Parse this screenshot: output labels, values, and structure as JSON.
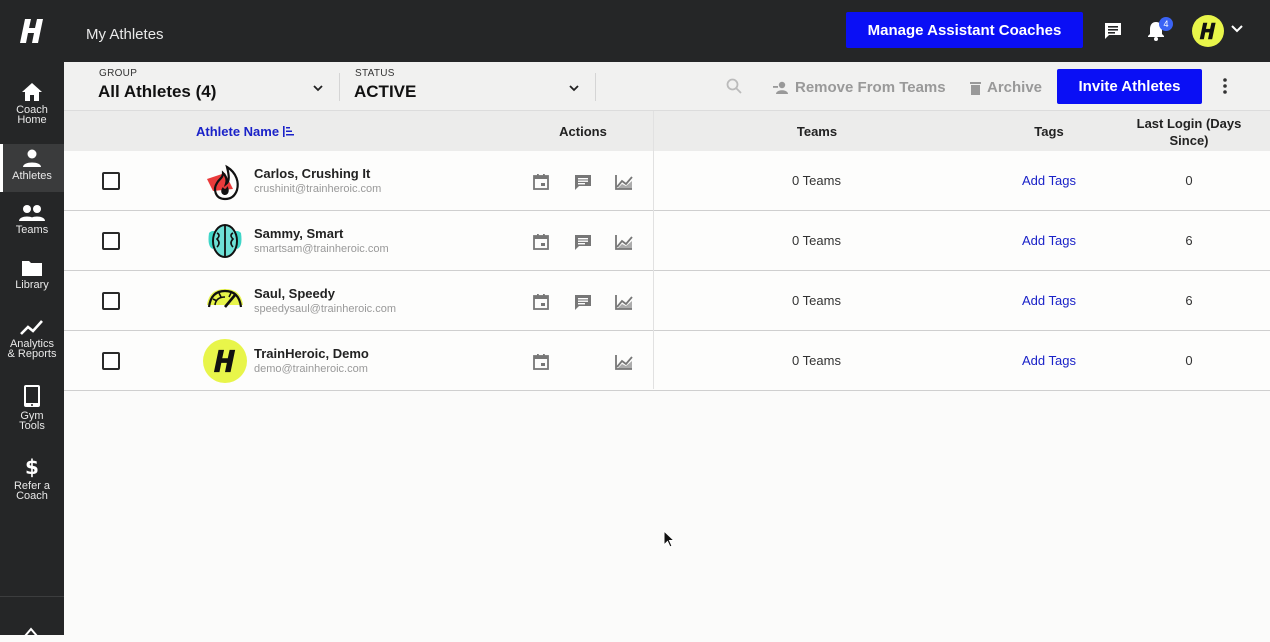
{
  "header": {
    "page_title": "My Athletes",
    "manage_button": "Manage Assistant Coaches",
    "notification_count": "4",
    "brand_color": "#0a0ff5"
  },
  "sidebar": {
    "items": [
      {
        "label": "Coach\nHome",
        "icon": "home-icon"
      },
      {
        "label": "Athletes",
        "icon": "person-icon"
      },
      {
        "label": "Teams",
        "icon": "group-icon"
      },
      {
        "label": "Library",
        "icon": "folder-icon"
      },
      {
        "label": "Analytics\n& Reports",
        "icon": "trend-icon"
      },
      {
        "label": "Gym\nTools",
        "icon": "tablet-icon"
      },
      {
        "label": "Refer a\nCoach",
        "icon": "dollar-icon"
      }
    ]
  },
  "filters": {
    "group_label": "GROUP",
    "group_value": "All Athletes (4)",
    "status_label": "STATUS",
    "status_value": "ACTIVE"
  },
  "toolbar": {
    "remove_label": "Remove From Teams",
    "archive_label": "Archive",
    "invite_label": "Invite Athletes"
  },
  "table": {
    "headers": {
      "name": "Athlete Name",
      "actions": "Actions",
      "teams": "Teams",
      "tags": "Tags",
      "last_login": "Last Login (Days Since)"
    },
    "rows": [
      {
        "name": "Carlos, Crushing It",
        "email": "crushinit@trainheroic.com",
        "teams": "0 Teams",
        "tags": "Add Tags",
        "last_login": "0",
        "avatar": "flame-icon",
        "has_message": true
      },
      {
        "name": "Sammy, Smart",
        "email": "smartsam@trainheroic.com",
        "teams": "0 Teams",
        "tags": "Add Tags",
        "last_login": "6",
        "avatar": "brain-icon",
        "has_message": true
      },
      {
        "name": "Saul, Speedy",
        "email": "speedysaul@trainheroic.com",
        "teams": "0 Teams",
        "tags": "Add Tags",
        "last_login": "6",
        "avatar": "speedometer-icon",
        "has_message": true
      },
      {
        "name": "TrainHeroic, Demo",
        "email": "demo@trainheroic.com",
        "teams": "0 Teams",
        "tags": "Add Tags",
        "last_login": "0",
        "avatar": "h-logo-icon",
        "has_message": false
      }
    ]
  }
}
